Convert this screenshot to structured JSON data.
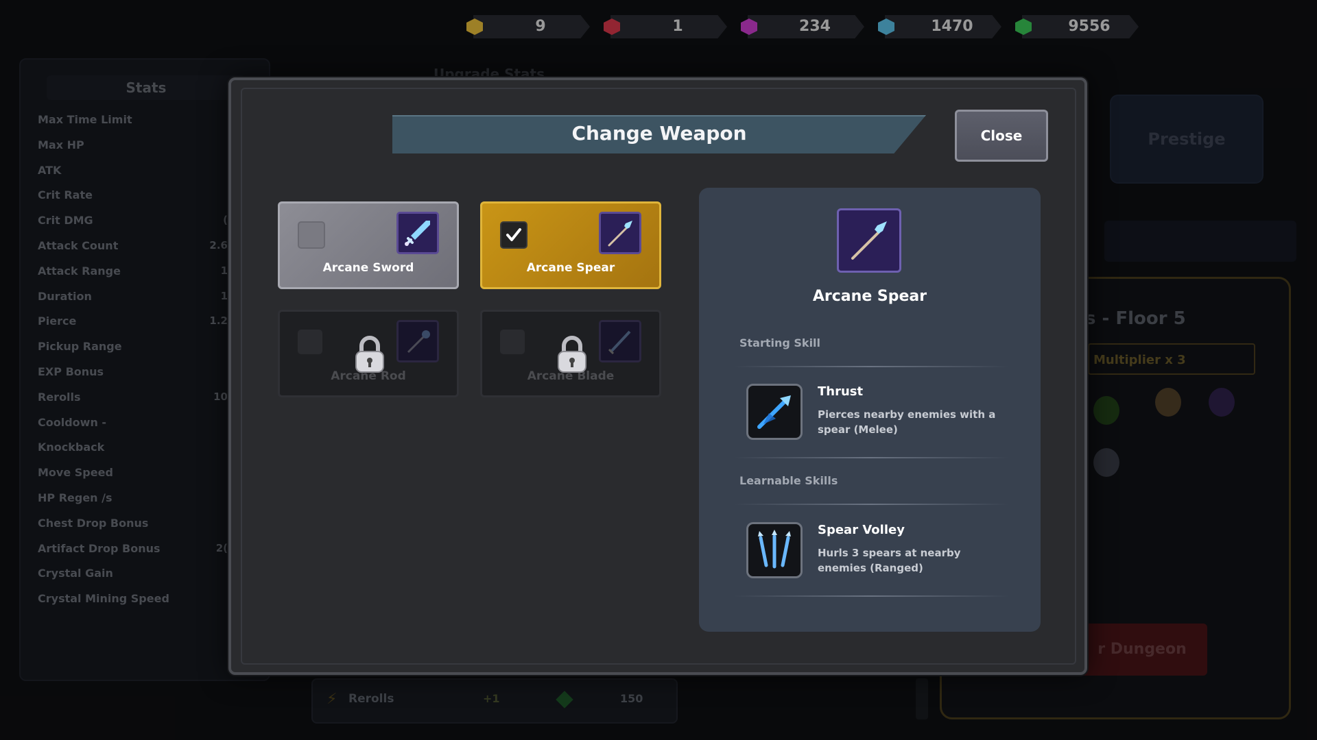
{
  "currencies": [
    {
      "name": "gold-gem",
      "value": "9",
      "color": "#f2c53d"
    },
    {
      "name": "red-gem",
      "value": "1",
      "color": "#e03a4d"
    },
    {
      "name": "purple-gem",
      "value": "234",
      "color": "#d43fd8"
    },
    {
      "name": "blue-gem",
      "value": "1470",
      "color": "#5ec8f0"
    },
    {
      "name": "green-gem",
      "value": "9556",
      "color": "#3dcc5a"
    }
  ],
  "background": {
    "stats_title": "Stats",
    "stats": [
      {
        "label": "Max Time Limit",
        "value": ""
      },
      {
        "label": "Max HP",
        "value": ""
      },
      {
        "label": "ATK",
        "value": ""
      },
      {
        "label": "Crit Rate",
        "value": ""
      },
      {
        "label": "Crit DMG",
        "value": "("
      },
      {
        "label": "Attack Count",
        "value": "2.6"
      },
      {
        "label": "Attack Range",
        "value": "1"
      },
      {
        "label": "Duration",
        "value": "1"
      },
      {
        "label": "Pierce",
        "value": "1.2"
      },
      {
        "label": "Pickup Range",
        "value": ""
      },
      {
        "label": "EXP Bonus",
        "value": ""
      },
      {
        "label": "Rerolls",
        "value": "10"
      },
      {
        "label": "Cooldown -",
        "value": ""
      },
      {
        "label": "Knockback",
        "value": ""
      },
      {
        "label": "Move Speed",
        "value": ""
      },
      {
        "label": "HP Regen /s",
        "value": ""
      },
      {
        "label": "Chest Drop Bonus",
        "value": ""
      },
      {
        "label": "Artifact Drop Bonus",
        "value": "2("
      },
      {
        "label": "Crystal Gain",
        "value": ""
      },
      {
        "label": "Crystal Mining Speed",
        "value": ""
      }
    ],
    "upgrade_title": "Upgrade Stats",
    "prestige_label": "Prestige",
    "floor_label": "s - Floor 5",
    "multiplier_label": "Multiplier  x 3",
    "dungeon_button": "r Dungeon",
    "reroll_row": {
      "label": "Rerolls",
      "bonus": "+1",
      "cost": "150"
    }
  },
  "modal": {
    "title": "Change Weapon",
    "close_label": "Close",
    "weapons": [
      {
        "name": "Arcane Sword",
        "state": "unlocked",
        "selected": false
      },
      {
        "name": "Arcane Spear",
        "state": "unlocked",
        "selected": true
      },
      {
        "name": "Arcane Rod",
        "state": "locked",
        "selected": false
      },
      {
        "name": "Arcane Blade",
        "state": "locked",
        "selected": false
      }
    ],
    "detail": {
      "weapon_name": "Arcane Spear",
      "starting_skill_label": "Starting Skill",
      "starting_skill": {
        "name": "Thrust",
        "description": "Pierces nearby enemies with a spear (Melee)"
      },
      "learnable_skills_label": "Learnable Skills",
      "learnable_skills": [
        {
          "name": "Spear Volley",
          "description": "Hurls 3 spears at nearby enemies (Ranged)"
        }
      ]
    }
  }
}
